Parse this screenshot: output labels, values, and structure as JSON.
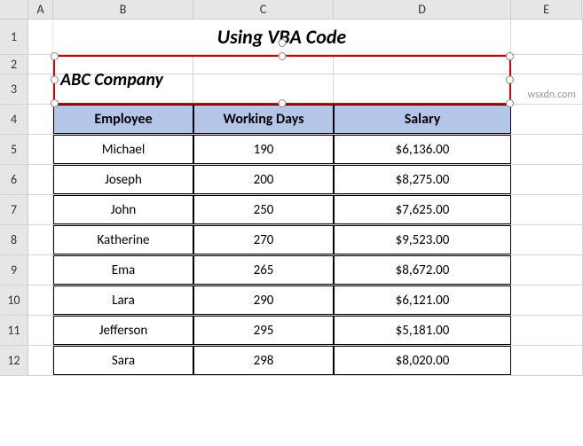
{
  "columns": {
    "A": "A",
    "B": "B",
    "C": "C",
    "D": "D",
    "E": "E"
  },
  "rows": [
    "1",
    "2",
    "3",
    "4",
    "5",
    "6",
    "7",
    "8",
    "9",
    "10",
    "11",
    "12"
  ],
  "title": "Using VBA Code",
  "textbox": {
    "text": "ABC Company"
  },
  "table": {
    "headers": {
      "employee": "Employee",
      "working_days": "Working Days",
      "salary": "Salary"
    },
    "data": [
      {
        "employee": "Michael",
        "working_days": "190",
        "salary": "$6,136.00"
      },
      {
        "employee": "Joseph",
        "working_days": "200",
        "salary": "$8,275.00"
      },
      {
        "employee": "John",
        "working_days": "250",
        "salary": "$7,625.00"
      },
      {
        "employee": "Katherine",
        "working_days": "270",
        "salary": "$9,523.00"
      },
      {
        "employee": "Ema",
        "working_days": "265",
        "salary": "$8,672.00"
      },
      {
        "employee": "Lara",
        "working_days": "290",
        "salary": "$6,121.00"
      },
      {
        "employee": "Jefferson",
        "working_days": "295",
        "salary": "$5,181.00"
      },
      {
        "employee": "Sara",
        "working_days": "298",
        "salary": "$8,020.00"
      }
    ]
  },
  "watermark": "wsxdn.com"
}
